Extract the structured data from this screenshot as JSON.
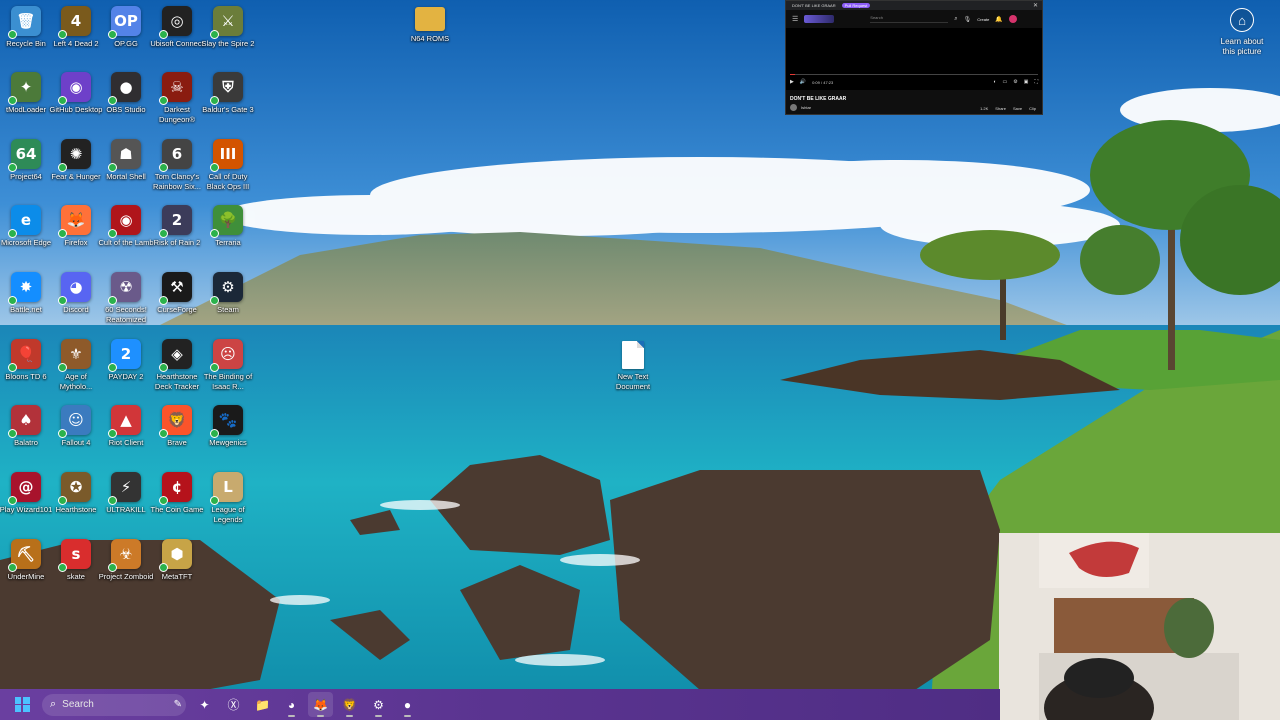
{
  "desktop": {
    "icons": [
      {
        "label": "Recycle Bin",
        "glyph": "🗑",
        "color": "#3b8fd1",
        "icon": "recycle-bin-icon"
      },
      {
        "label": "Left 4 Dead 2",
        "glyph": "4",
        "color": "#7a5a1c",
        "icon": "left-4-dead-icon"
      },
      {
        "label": "OP.GG",
        "glyph": "OP",
        "color": "#5383e8",
        "icon": "opgg-icon"
      },
      {
        "label": "Ubisoft Connect",
        "glyph": "◎",
        "color": "#222222",
        "icon": "ubisoft-icon"
      },
      {
        "label": "Slay the Spire 2",
        "glyph": "⚔",
        "color": "#6b7d3a",
        "icon": "slay-the-spire-icon"
      },
      {
        "label": "tModLoader",
        "glyph": "✦",
        "color": "#4c7a3a",
        "icon": "tmodloader-icon"
      },
      {
        "label": "GitHub Desktop",
        "glyph": "◉",
        "color": "#6e40c9",
        "icon": "github-desktop-icon"
      },
      {
        "label": "OBS Studio",
        "glyph": "●",
        "color": "#302e31",
        "icon": "obs-icon"
      },
      {
        "label": "Darkest Dungeon®",
        "glyph": "☠",
        "color": "#8a1c10",
        "icon": "darkest-dungeon-icon"
      },
      {
        "label": "Baldur's Gate 3",
        "glyph": "⛨",
        "color": "#3a3a3a",
        "icon": "baldurs-gate-icon"
      },
      {
        "label": "Project64",
        "glyph": "64",
        "color": "#2e8b57",
        "icon": "project64-icon"
      },
      {
        "label": "Fear & Hunger",
        "glyph": "✺",
        "color": "#222222",
        "icon": "fear-hunger-icon"
      },
      {
        "label": "Mortal Shell",
        "glyph": "☗",
        "color": "#555555",
        "icon": "mortal-shell-icon"
      },
      {
        "label": "Tom Clancy's Rainbow Six...",
        "glyph": "6",
        "color": "#444444",
        "icon": "rainbow-six-icon"
      },
      {
        "label": "Call of Duty Black Ops III",
        "glyph": "III",
        "color": "#d35400",
        "icon": "black-ops-icon"
      },
      {
        "label": "Microsoft Edge",
        "glyph": "e",
        "color": "#0c8ce9",
        "icon": "edge-icon"
      },
      {
        "label": "Firefox",
        "glyph": "🦊",
        "color": "#ff7139",
        "icon": "firefox-icon"
      },
      {
        "label": "Cult of the Lamb",
        "glyph": "◉",
        "color": "#b0151b",
        "icon": "cult-of-lamb-icon"
      },
      {
        "label": "Risk of Rain 2",
        "glyph": "2",
        "color": "#3c3c5a",
        "icon": "risk-of-rain-icon"
      },
      {
        "label": "Terraria",
        "glyph": "🌳",
        "color": "#3f8f3a",
        "icon": "terraria-icon"
      },
      {
        "label": "Battle.net",
        "glyph": "✸",
        "color": "#148eff",
        "icon": "battlenet-icon"
      },
      {
        "label": "Discord",
        "glyph": "◕",
        "color": "#5865f2",
        "icon": "discord-icon"
      },
      {
        "label": "60 Seconds! Reatomized",
        "glyph": "☢",
        "color": "#6a5a8a",
        "icon": "60-seconds-icon"
      },
      {
        "label": "CurseForge",
        "glyph": "⚒",
        "color": "#1a1a1a",
        "icon": "curseforge-icon"
      },
      {
        "label": "Steam",
        "glyph": "⚙",
        "color": "#1b2838",
        "icon": "steam-icon"
      },
      {
        "label": "Bloons TD 6",
        "glyph": "🎈",
        "color": "#c0392b",
        "icon": "bloons-icon"
      },
      {
        "label": "Age of Mytholo...",
        "glyph": "⚜",
        "color": "#8e5a2a",
        "icon": "age-of-mythology-icon"
      },
      {
        "label": "PAYDAY 2",
        "glyph": "2",
        "color": "#1e90ff",
        "icon": "payday-icon"
      },
      {
        "label": "Hearthstone Deck Tracker",
        "glyph": "◈",
        "color": "#222222",
        "icon": "hearthstone-deck-tracker-icon"
      },
      {
        "label": "The Binding of Isaac R...",
        "glyph": "☹",
        "color": "#c44",
        "icon": "binding-of-isaac-icon"
      },
      {
        "label": "Balatro",
        "glyph": "♠",
        "color": "#b2323a",
        "icon": "balatro-icon"
      },
      {
        "label": "Fallout 4",
        "glyph": "☺",
        "color": "#3b7bbf",
        "icon": "fallout-icon"
      },
      {
        "label": "Riot Client",
        "glyph": "▲",
        "color": "#d13639",
        "icon": "riot-client-icon"
      },
      {
        "label": "Brave",
        "glyph": "🦁",
        "color": "#fb542b",
        "icon": "brave-icon"
      },
      {
        "label": "Mewgenics",
        "glyph": "🐾",
        "color": "#1a1a1a",
        "icon": "mewgenics-icon"
      },
      {
        "label": "Play Wizard101",
        "glyph": "@",
        "color": "#a8132c",
        "icon": "wizard101-icon"
      },
      {
        "label": "Hearthstone",
        "glyph": "✪",
        "color": "#7a5a2a",
        "icon": "hearthstone-icon"
      },
      {
        "label": "ULTRAKILL",
        "glyph": "⚡",
        "color": "#333333",
        "icon": "ultrakill-icon"
      },
      {
        "label": "The Coin Game",
        "glyph": "¢",
        "color": "#b5121b",
        "icon": "coin-game-icon"
      },
      {
        "label": "League of Legends",
        "glyph": "L",
        "color": "#c8aa6e",
        "icon": "league-of-legends-icon"
      },
      {
        "label": "UnderMine",
        "glyph": "⛏",
        "color": "#b8701a",
        "icon": "undermine-icon"
      },
      {
        "label": "skate",
        "glyph": "s",
        "color": "#d92d2d",
        "icon": "skate-icon"
      },
      {
        "label": "Project Zomboid",
        "glyph": "☣",
        "color": "#cc7a28",
        "icon": "project-zomboid-icon"
      },
      {
        "label": "MetaTFT",
        "glyph": "⬢",
        "color": "#c7a447",
        "icon": "metatft-icon"
      }
    ],
    "n64_roms": {
      "label": "N64 ROMS"
    },
    "new_text_document": {
      "label": "New Text Document"
    },
    "learn_about": {
      "label": "Learn about this picture"
    }
  },
  "youtube_window": {
    "tab_title": "DON'T BE LIKE GRAAR",
    "tab_badge": "Pull Request",
    "search_placeholder": "Search",
    "create_label": "Create",
    "time_label": "0:09 / 47:23",
    "video_title": "DON'T BE LIKE GRAAR",
    "channel_name": "Ishtar",
    "action_like": "1.2K",
    "action_share": "Share",
    "action_save": "Save",
    "action_clip": "Clip",
    "progress": 0.02
  },
  "taskbar": {
    "search_placeholder": "Search",
    "apps": [
      {
        "name": "file-copilot-icon",
        "glyph": "✦"
      },
      {
        "name": "xbox-icon",
        "glyph": "Ⓧ"
      },
      {
        "name": "file-explorer-icon",
        "glyph": "📁"
      },
      {
        "name": "discord-taskbar-icon",
        "glyph": "◕"
      },
      {
        "name": "firefox-taskbar-icon",
        "glyph": "🦊"
      },
      {
        "name": "brave-taskbar-icon",
        "glyph": "🦁"
      },
      {
        "name": "steam-taskbar-icon",
        "glyph": "⚙"
      },
      {
        "name": "obs-taskbar-icon",
        "glyph": "●"
      }
    ]
  },
  "colors": {
    "taskbar": "#5a3490",
    "accent": "#4cc2ff"
  }
}
